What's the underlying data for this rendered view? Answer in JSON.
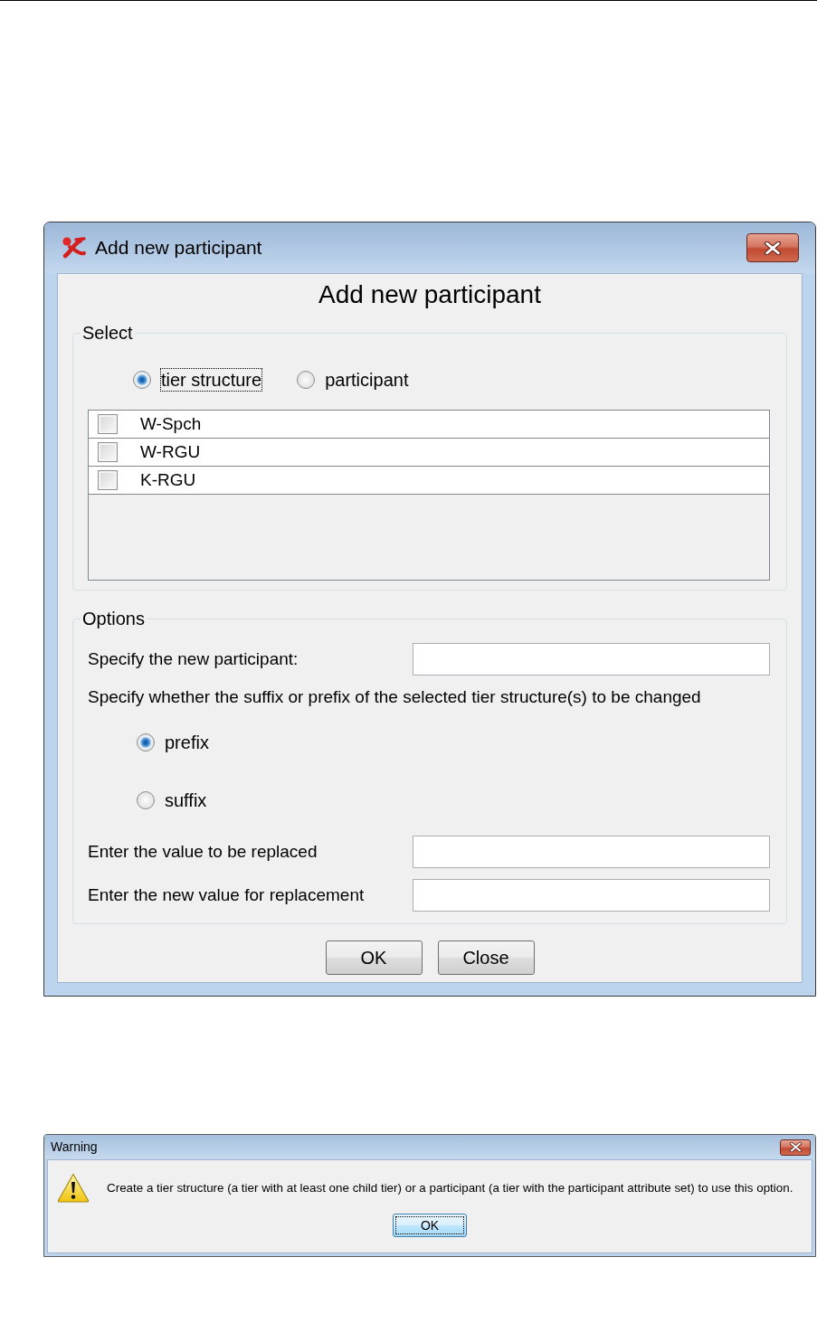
{
  "main_dialog": {
    "title": "Add new participant",
    "heading": "Add new participant",
    "select_group": {
      "legend": "Select",
      "modes": [
        {
          "label": "tier structure",
          "selected": true,
          "focused": true
        },
        {
          "label": "participant",
          "selected": false,
          "focused": false
        }
      ],
      "tiers": [
        {
          "label": "W-Spch",
          "checked": false
        },
        {
          "label": "W-RGU",
          "checked": false
        },
        {
          "label": "K-RGU",
          "checked": false
        }
      ]
    },
    "options_group": {
      "legend": "Options",
      "participant_field": {
        "label": "Specify the new participant:"
      },
      "affix_prompt": "Specify whether the suffix or prefix of the selected tier structure(s) to be changed",
      "affix_choices": [
        {
          "label": "prefix",
          "selected": true
        },
        {
          "label": "suffix",
          "selected": false
        }
      ],
      "value_fields": [
        {
          "label": "Enter the value to be replaced"
        },
        {
          "label": "Enter the new value for replacement"
        }
      ]
    },
    "buttons": [
      {
        "label": "OK"
      },
      {
        "label": "Close"
      }
    ]
  },
  "warning_dialog": {
    "title": "Warning",
    "message": "Create a tier structure (a tier with at least one child tier) or a participant (a tier with the participant attribute set) to use this option.",
    "buttons": [
      {
        "label": "OK",
        "focused": true
      }
    ]
  }
}
